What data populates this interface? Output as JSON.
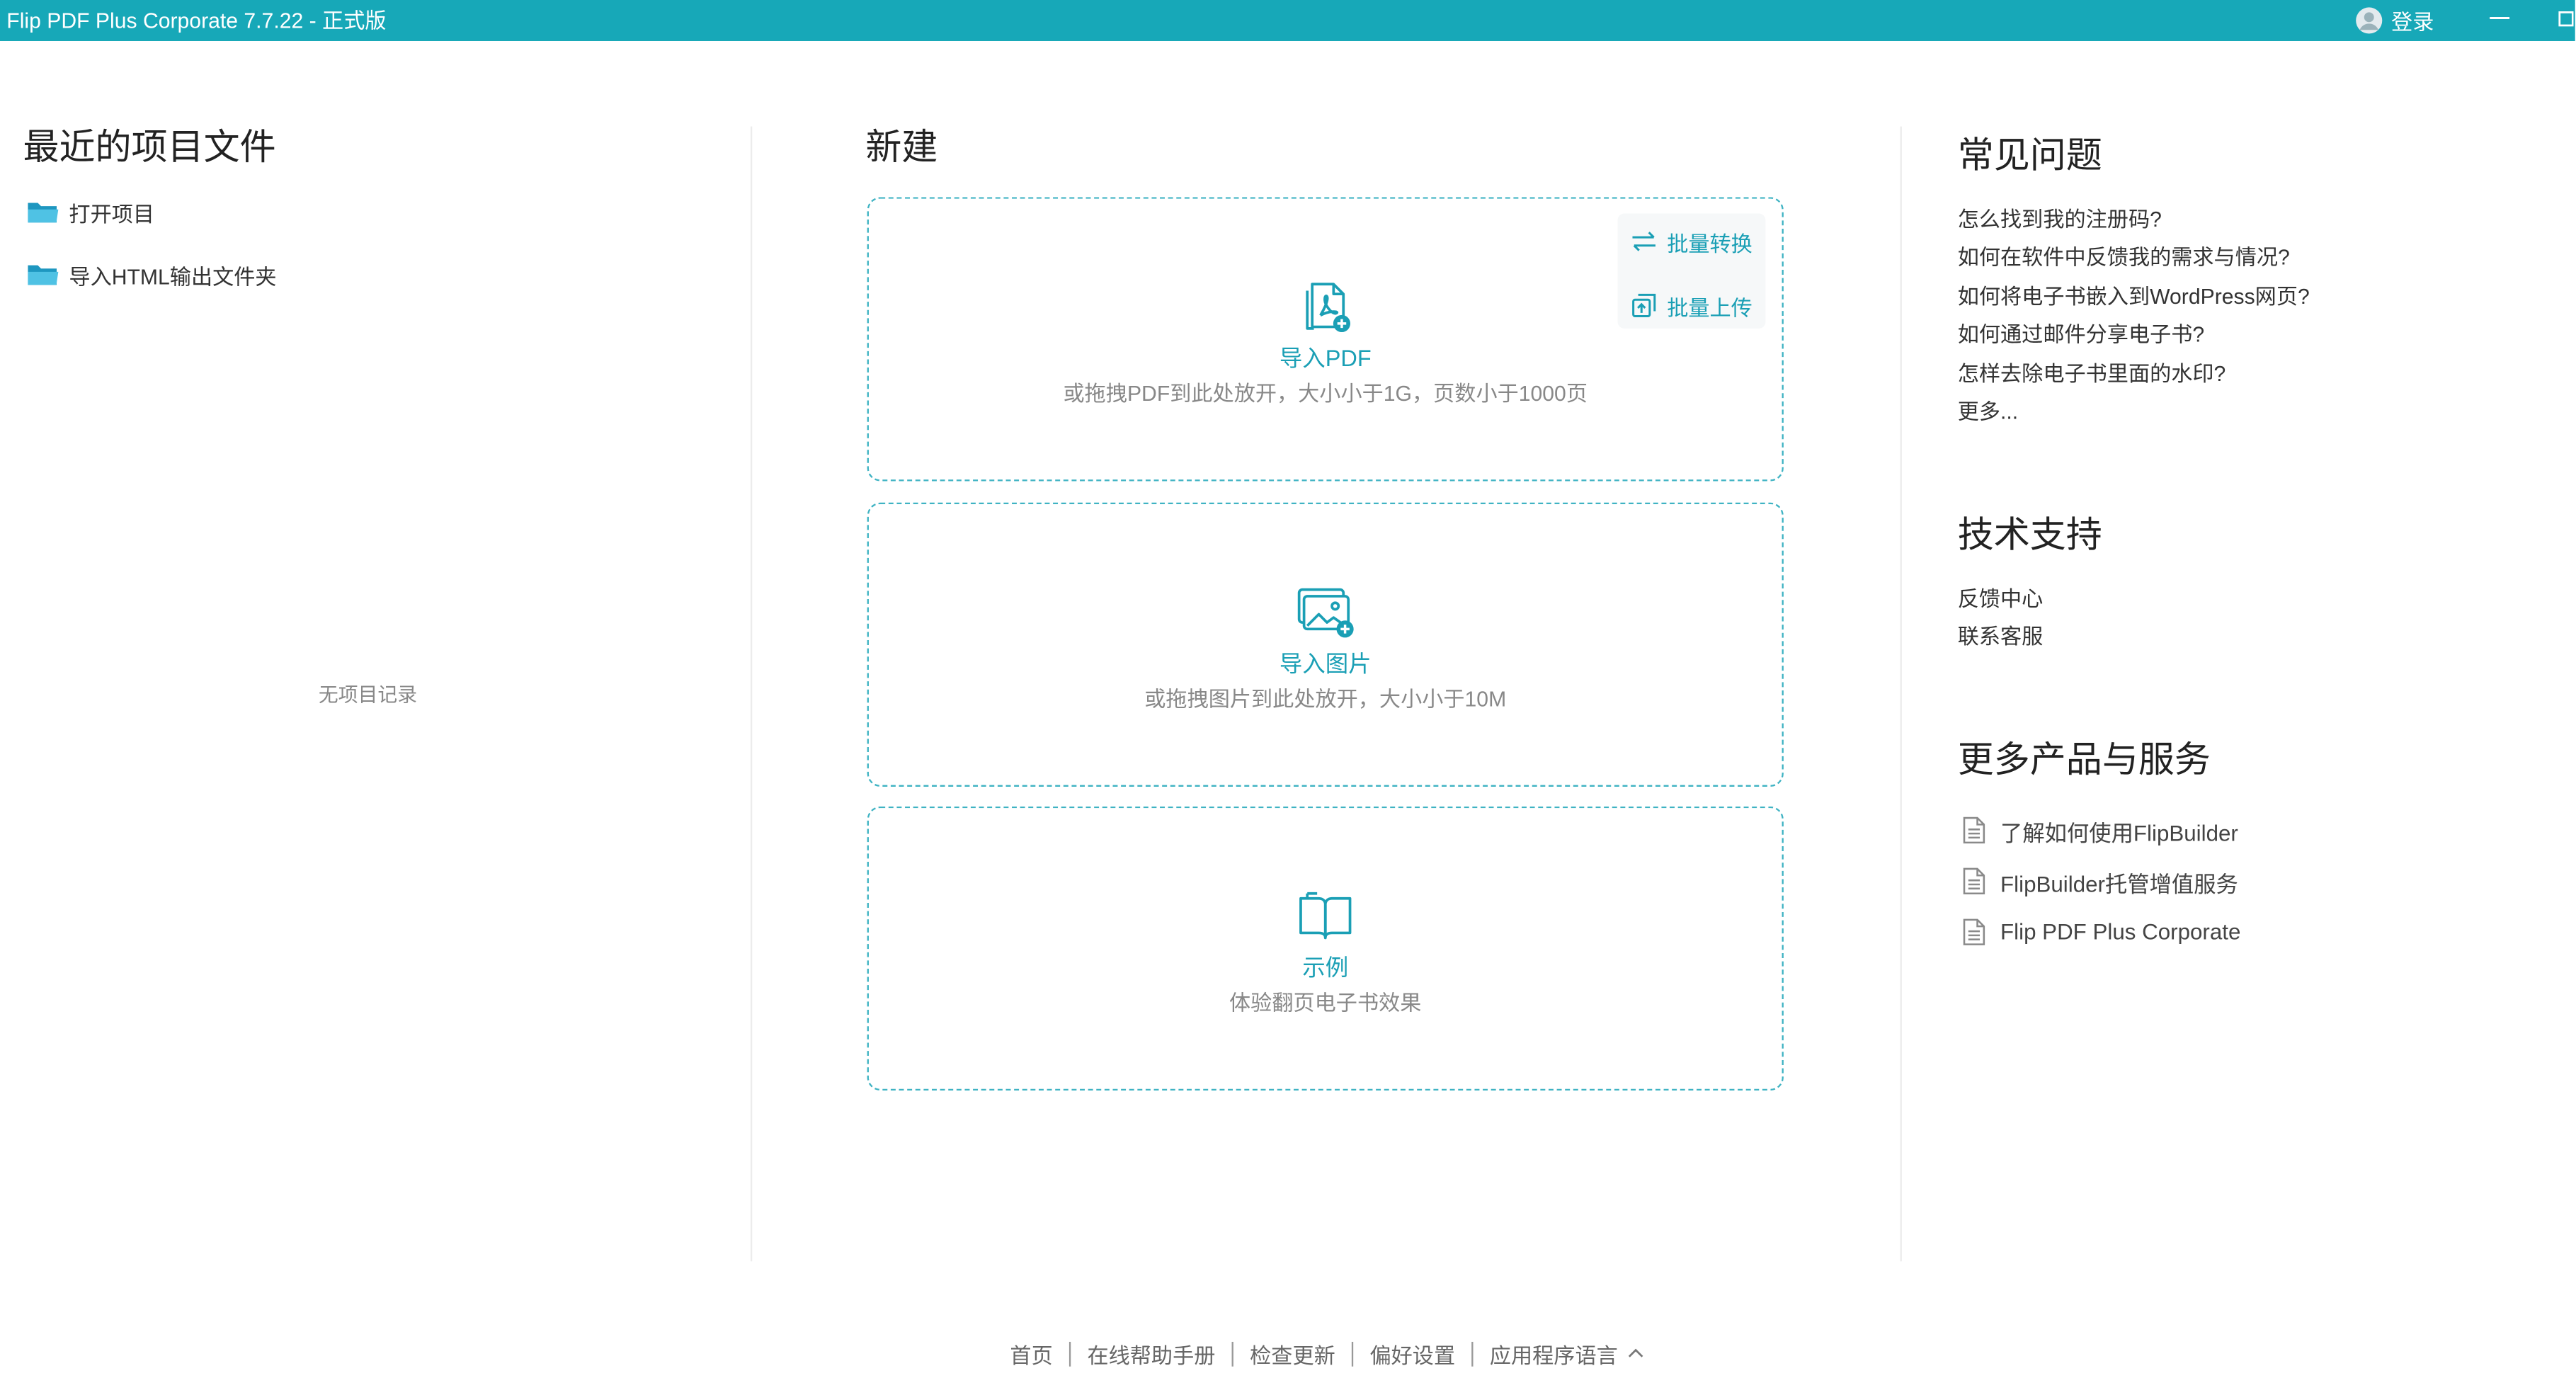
{
  "window": {
    "title": "Flip PDF Plus Corporate 7.7.22 - 正式版",
    "login_label": "登录",
    "icons": {
      "user": "user-avatar-icon",
      "minimize": "minimize-icon",
      "maximize": "maximize-icon"
    }
  },
  "colors": {
    "titlebar": "#17a8b8",
    "accent_text": "#1a9fb5",
    "card_border": "#3fb3c3",
    "text": "#333333",
    "muted_text": "#888888"
  },
  "recent": {
    "title": "最近的项目文件",
    "actions": [
      {
        "label": "打开项目",
        "icon": "folder-icon"
      },
      {
        "label": "导入HTML输出文件夹",
        "icon": "folder-icon"
      }
    ],
    "empty_text": "无项目记录"
  },
  "create": {
    "title": "新建",
    "cards": [
      {
        "label": "导入PDF",
        "hint": "或拖拽PDF到此处放开，大小小于1G，页数小于1000页",
        "icon": "import-pdf-icon"
      },
      {
        "label": "导入图片",
        "hint": "或拖拽图片到此处放开，大小小于10M",
        "icon": "import-image-icon"
      },
      {
        "label": "示例",
        "hint": "体验翻页电子书效果",
        "icon": "open-book-icon"
      }
    ],
    "batch_actions": [
      {
        "label": "批量转换",
        "icon": "swap-arrows-icon"
      },
      {
        "label": "批量上传",
        "icon": "upload-icon"
      }
    ]
  },
  "faq": {
    "title": "常见问题",
    "links": [
      "怎么找到我的注册码?",
      "如何在软件中反馈我的需求与情况?",
      "如何将电子书嵌入到WordPress网页?",
      "如何通过邮件分享电子书?",
      "怎样去除电子书里面的水印?",
      "更多..."
    ]
  },
  "support": {
    "title": "技术支持",
    "links": [
      "反馈中心",
      "联系客服"
    ]
  },
  "more_products": {
    "title": "更多产品与服务",
    "links": [
      {
        "label": "了解如何使用FlipBuilder",
        "icon": "document-icon"
      },
      {
        "label": "FlipBuilder托管增值服务",
        "icon": "document-icon"
      },
      {
        "label": "Flip PDF Plus Corporate",
        "icon": "document-icon"
      }
    ]
  },
  "footer": {
    "links": [
      "首页",
      "在线帮助手册",
      "检查更新",
      "偏好设置",
      "应用程序语言"
    ],
    "language_toggle_icon": "chevron-up-icon"
  }
}
